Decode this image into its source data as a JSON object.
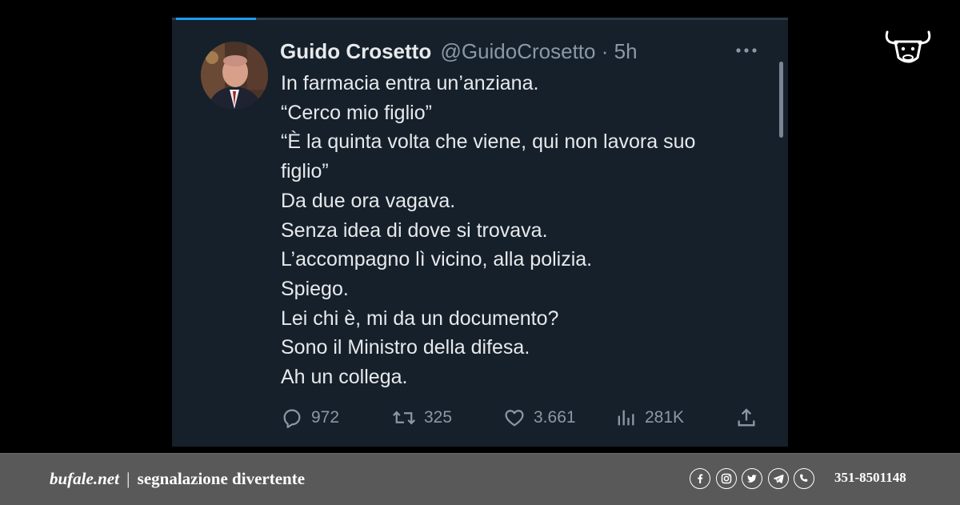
{
  "tweet": {
    "author_name": "Guido Crosetto",
    "author_handle": "@GuidoCrosetto",
    "separator": "·",
    "time": "5h",
    "lines": [
      "In farmacia entra un’anziana.",
      "“Cerco mio figlio”",
      "“È la quinta volta che viene, qui non lavora suo",
      "figlio”",
      "Da due ora vagava.",
      "Senza idea di dove si trovava.",
      "L’accompagno lì vicino, alla polizia.",
      "Spiego.",
      "Lei chi è, mi da un documento?",
      "Sono il Ministro della difesa.",
      "Ah un collega."
    ],
    "stats": {
      "replies": "972",
      "retweets": "325",
      "likes": "3.661",
      "views": "281K"
    },
    "icons": {
      "reply": "reply-icon",
      "retweet": "retweet-icon",
      "like": "heart-icon",
      "views": "views-icon",
      "share": "share-icon",
      "more": "more-icon"
    }
  },
  "footer": {
    "brand": "bufale.net",
    "separator": "|",
    "tagline": "segnalazione divertente",
    "phone": "351-8501148",
    "social_icons": [
      "facebook-icon",
      "instagram-icon",
      "twitter-icon",
      "telegram-icon",
      "whatsapp-icon"
    ]
  },
  "colors": {
    "page_background": "#000000",
    "tweet_background": "#15202b",
    "primary_text": "#e7e9ea",
    "secondary_text": "#8b98a5",
    "accent": "#1d9bf0",
    "footer_background": "#595959"
  }
}
